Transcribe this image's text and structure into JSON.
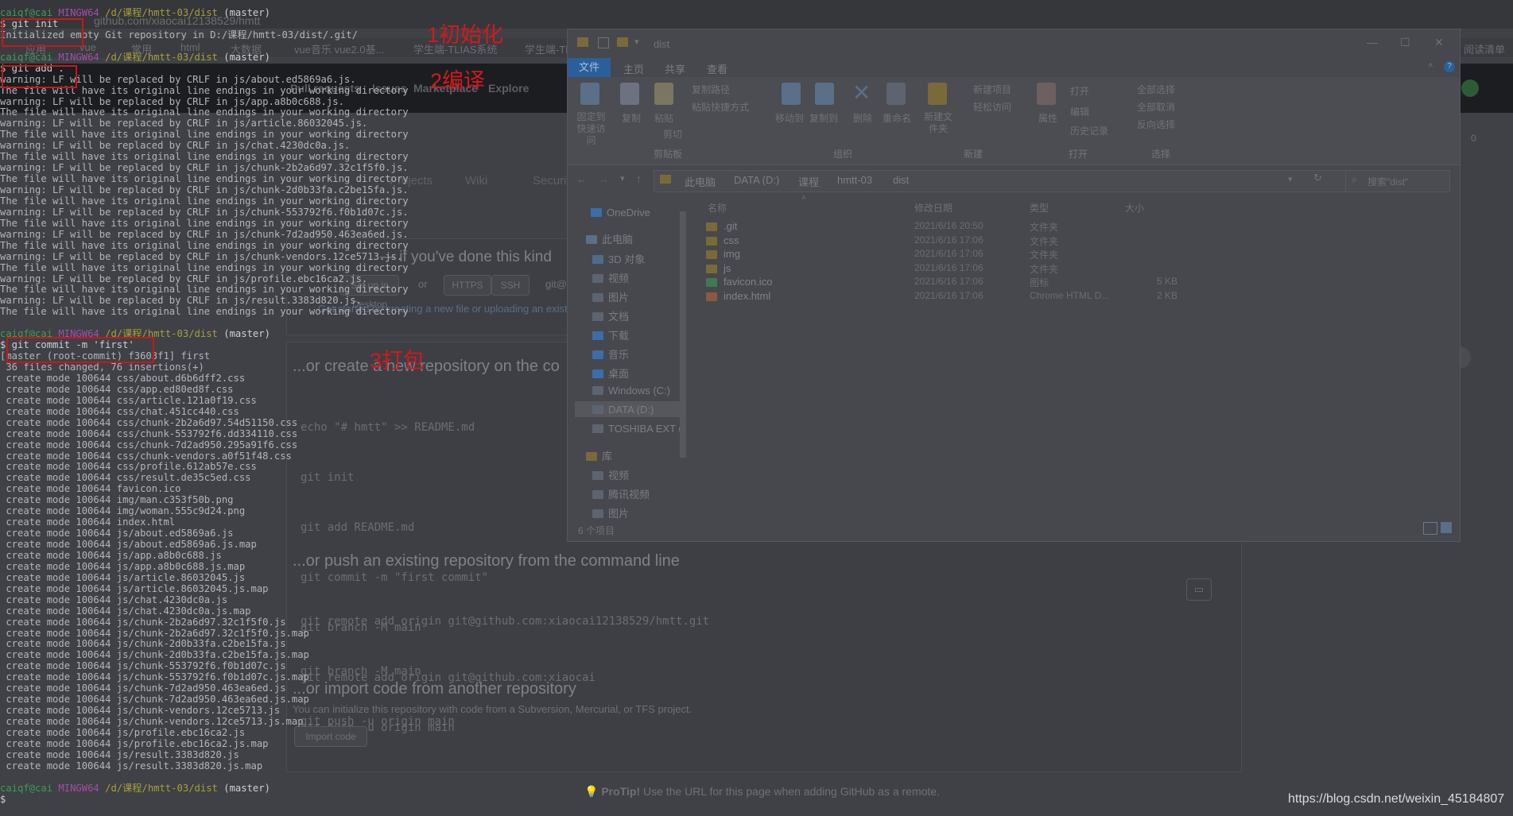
{
  "github": {
    "tab_title": "github.com/xiaocai12138529/hmtt",
    "bookmarks": [
      "应用",
      "vue",
      "常用",
      "html",
      "大数据",
      "vue音乐 vue2.0基...",
      "学生端-TLIAS系统",
      "学生端-TL"
    ],
    "reading_list": "阅读清单",
    "nav": [
      "Pull requests",
      "Issues",
      "Marketplace",
      "Explore"
    ],
    "repo_tabs": [
      "Projects",
      "Wiki",
      "Security"
    ],
    "counter": "0",
    "quick_setup": "— if you've done this kind",
    "setup_buttons": [
      "Set up in Desktop",
      "or",
      "HTTPS",
      "SSH",
      "git@"
    ],
    "get_started": "Get started by creating a new file or uploading an existing",
    "sections": [
      {
        "title": "...or create a new repository on the co",
        "code": [
          "echo \"# hmtt\" >> README.md",
          "git init",
          "git add README.md",
          "git commit -m \"first commit\"",
          "git branch -M main",
          "git remote add origin git@github.com:xiaocai",
          "git push -u origin main"
        ]
      },
      {
        "title": "...or push an existing repository from the command line",
        "code": [
          "git remote add origin git@github.com:xiaocai12138529/hmtt.git",
          "git branch -M main",
          "git push -u origin main"
        ]
      },
      {
        "title": "...or import code from another repository",
        "code": []
      }
    ],
    "import_desc": "You can initialize this repository with code from a Subversion, Mercurial, or TFS project.",
    "import_button": "Import code",
    "protip_label": "ProTip!",
    "protip_text": " Use the URL for this page when adding GitHub as a remote.",
    "watermark": "https://blog.csdn.net/weixin_45184807"
  },
  "terminal": {
    "prompt_user": "caiqf@cai",
    "prompt_sys": "MINGW64",
    "prompt_path": "/d/课程/hmtt-03/dist",
    "prompt_branch": "(master)",
    "lines": [
      {
        "t": "prompt"
      },
      {
        "t": "cmd",
        "text": "$ git init"
      },
      {
        "t": "out",
        "text": "Initialized empty Git repository in D:/课程/hmtt-03/dist/.git/"
      },
      {
        "t": "blank"
      },
      {
        "t": "prompt"
      },
      {
        "t": "cmd",
        "text": "$ git add ."
      },
      {
        "t": "out",
        "text": "warning: LF will be replaced by CRLF in js/about.ed5869a6.js."
      },
      {
        "t": "out",
        "text": "The file will have its original line endings in your working directory"
      },
      {
        "t": "out",
        "text": "warning: LF will be replaced by CRLF in js/app.a8b0c688.js."
      },
      {
        "t": "out",
        "text": "The file will have its original line endings in your working directory"
      },
      {
        "t": "out",
        "text": "warning: LF will be replaced by CRLF in js/article.86032045.js."
      },
      {
        "t": "out",
        "text": "The file will have its original line endings in your working directory"
      },
      {
        "t": "out",
        "text": "warning: LF will be replaced by CRLF in js/chat.4230dc0a.js."
      },
      {
        "t": "out",
        "text": "The file will have its original line endings in your working directory"
      },
      {
        "t": "out",
        "text": "warning: LF will be replaced by CRLF in js/chunk-2b2a6d97.32c1f5f0.js."
      },
      {
        "t": "out",
        "text": "The file will have its original line endings in your working directory"
      },
      {
        "t": "out",
        "text": "warning: LF will be replaced by CRLF in js/chunk-2d0b33fa.c2be15fa.js."
      },
      {
        "t": "out",
        "text": "The file will have its original line endings in your working directory"
      },
      {
        "t": "out",
        "text": "warning: LF will be replaced by CRLF in js/chunk-553792f6.f0b1d07c.js."
      },
      {
        "t": "out",
        "text": "The file will have its original line endings in your working directory"
      },
      {
        "t": "out",
        "text": "warning: LF will be replaced by CRLF in js/chunk-7d2ad950.463ea6ed.js."
      },
      {
        "t": "out",
        "text": "The file will have its original line endings in your working directory"
      },
      {
        "t": "out",
        "text": "warning: LF will be replaced by CRLF in js/chunk-vendors.12ce5713.js."
      },
      {
        "t": "out",
        "text": "The file will have its original line endings in your working directory"
      },
      {
        "t": "out",
        "text": "warning: LF will be replaced by CRLF in js/profile.ebc16ca2.js."
      },
      {
        "t": "out",
        "text": "The file will have its original line endings in your working directory"
      },
      {
        "t": "out",
        "text": "warning: LF will be replaced by CRLF in js/result.3383d820.js."
      },
      {
        "t": "out",
        "text": "The file will have its original line endings in your working directory"
      },
      {
        "t": "blank"
      },
      {
        "t": "prompt"
      },
      {
        "t": "cmd",
        "text": "$ git commit -m 'first'"
      },
      {
        "t": "out",
        "text": "[master (root-commit) f3603f1] first"
      },
      {
        "t": "out",
        "text": " 36 files changed, 76 insertions(+)"
      },
      {
        "t": "out",
        "text": " create mode 100644 css/about.d6b6dff2.css"
      },
      {
        "t": "out",
        "text": " create mode 100644 css/app.ed80ed8f.css"
      },
      {
        "t": "out",
        "text": " create mode 100644 css/article.121a0f19.css"
      },
      {
        "t": "out",
        "text": " create mode 100644 css/chat.451cc440.css"
      },
      {
        "t": "out",
        "text": " create mode 100644 css/chunk-2b2a6d97.54d51150.css"
      },
      {
        "t": "out",
        "text": " create mode 100644 css/chunk-553792f6.dd334110.css"
      },
      {
        "t": "out",
        "text": " create mode 100644 css/chunk-7d2ad950.295a91f6.css"
      },
      {
        "t": "out",
        "text": " create mode 100644 css/chunk-vendors.a0f51f48.css"
      },
      {
        "t": "out",
        "text": " create mode 100644 css/profile.612ab57e.css"
      },
      {
        "t": "out",
        "text": " create mode 100644 css/result.de35c5ed.css"
      },
      {
        "t": "out",
        "text": " create mode 100644 favicon.ico"
      },
      {
        "t": "out",
        "text": " create mode 100644 img/man.c353f50b.png"
      },
      {
        "t": "out",
        "text": " create mode 100644 img/woman.555c9d24.png"
      },
      {
        "t": "out",
        "text": " create mode 100644 index.html"
      },
      {
        "t": "out",
        "text": " create mode 100644 js/about.ed5869a6.js"
      },
      {
        "t": "out",
        "text": " create mode 100644 js/about.ed5869a6.js.map"
      },
      {
        "t": "out",
        "text": " create mode 100644 js/app.a8b0c688.js"
      },
      {
        "t": "out",
        "text": " create mode 100644 js/app.a8b0c688.js.map"
      },
      {
        "t": "out",
        "text": " create mode 100644 js/article.86032045.js"
      },
      {
        "t": "out",
        "text": " create mode 100644 js/article.86032045.js.map"
      },
      {
        "t": "out",
        "text": " create mode 100644 js/chat.4230dc0a.js"
      },
      {
        "t": "out",
        "text": " create mode 100644 js/chat.4230dc0a.js.map"
      },
      {
        "t": "out",
        "text": " create mode 100644 js/chunk-2b2a6d97.32c1f5f0.js"
      },
      {
        "t": "out",
        "text": " create mode 100644 js/chunk-2b2a6d97.32c1f5f0.js.map"
      },
      {
        "t": "out",
        "text": " create mode 100644 js/chunk-2d0b33fa.c2be15fa.js"
      },
      {
        "t": "out",
        "text": " create mode 100644 js/chunk-2d0b33fa.c2be15fa.js.map"
      },
      {
        "t": "out",
        "text": " create mode 100644 js/chunk-553792f6.f0b1d07c.js"
      },
      {
        "t": "out",
        "text": " create mode 100644 js/chunk-553792f6.f0b1d07c.js.map"
      },
      {
        "t": "out",
        "text": " create mode 100644 js/chunk-7d2ad950.463ea6ed.js"
      },
      {
        "t": "out",
        "text": " create mode 100644 js/chunk-7d2ad950.463ea6ed.js.map"
      },
      {
        "t": "out",
        "text": " create mode 100644 js/chunk-vendors.12ce5713.js"
      },
      {
        "t": "out",
        "text": " create mode 100644 js/chunk-vendors.12ce5713.js.map"
      },
      {
        "t": "out",
        "text": " create mode 100644 js/profile.ebc16ca2.js"
      },
      {
        "t": "out",
        "text": " create mode 100644 js/profile.ebc16ca2.js.map"
      },
      {
        "t": "out",
        "text": " create mode 100644 js/result.3383d820.js"
      },
      {
        "t": "out",
        "text": " create mode 100644 js/result.3383d820.js.map"
      },
      {
        "t": "blank"
      },
      {
        "t": "prompt"
      },
      {
        "t": "cmd",
        "text": "$"
      }
    ],
    "annotations": [
      "1初始化",
      "2编译",
      "3打包"
    ]
  },
  "explorer": {
    "title": "dist",
    "tabs": [
      "文件",
      "主页",
      "共享",
      "查看"
    ],
    "ribbon": {
      "items": [
        "固定到快速访问",
        "复制",
        "粘贴",
        "复制路径",
        "粘贴快捷方式",
        "剪切",
        "移动到",
        "复制到",
        "删除",
        "重命名",
        "新建文件夹",
        "新建项目",
        "轻松访问",
        "属性",
        "打开",
        "编辑",
        "历史记录",
        "全部选择",
        "全部取消",
        "反向选择"
      ],
      "groups": [
        "剪贴板",
        "组织",
        "新建",
        "打开",
        "选择"
      ]
    },
    "breadcrumb": [
      "此电脑",
      "DATA (D:)",
      "课程",
      "hmtt-03",
      "dist"
    ],
    "search_placeholder": "搜索\"dist\"",
    "nav": [
      "OneDrive",
      "此电脑",
      "3D 对象",
      "视频",
      "图片",
      "文档",
      "下载",
      "音乐",
      "桌面",
      "Windows (C:)",
      "DATA (D:)",
      "TOSHIBA EXT (",
      "库",
      "视频",
      "腾讯视频",
      "图片"
    ],
    "columns": [
      "名称",
      "修改日期",
      "类型",
      "大小"
    ],
    "files": [
      {
        "name": ".git",
        "date": "2021/6/16 20:50",
        "type": "文件夹",
        "size": ""
      },
      {
        "name": "css",
        "date": "2021/6/16 17:06",
        "type": "文件夹",
        "size": ""
      },
      {
        "name": "img",
        "date": "2021/6/16 17:06",
        "type": "文件夹",
        "size": ""
      },
      {
        "name": "js",
        "date": "2021/6/16 17:06",
        "type": "文件夹",
        "size": ""
      },
      {
        "name": "favicon.ico",
        "date": "2021/6/16 17:06",
        "type": "图标",
        "size": "5 KB"
      },
      {
        "name": "index.html",
        "date": "2021/6/16 17:06",
        "type": "Chrome HTML D...",
        "size": "2 KB"
      }
    ],
    "status": "6 个项目"
  }
}
